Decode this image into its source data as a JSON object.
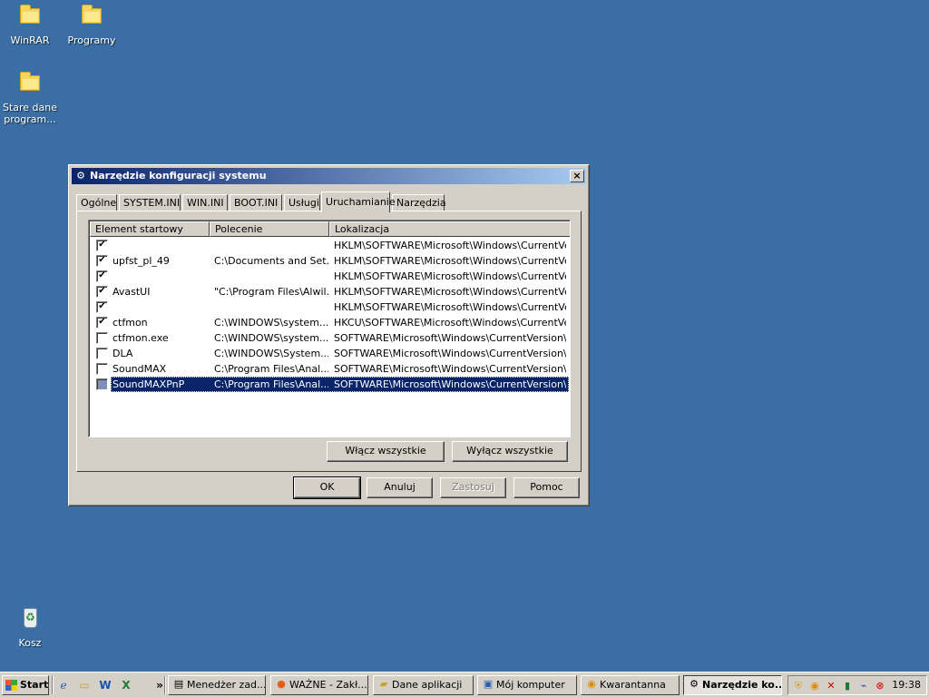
{
  "desktop": {
    "icons": [
      {
        "label": "WinRAR"
      },
      {
        "label": "Programy"
      },
      {
        "label": "Stare dane program..."
      },
      {
        "label": "Kosz"
      }
    ]
  },
  "dialog": {
    "title": "Narzędzie konfiguracji systemu",
    "close_glyph": "×",
    "tabs": [
      "Ogólne",
      "SYSTEM.INI",
      "WIN.INI",
      "BOOT.INI",
      "Usługi",
      "Uruchamianie",
      "Narzędzia"
    ],
    "active_tab": "Uruchamianie",
    "columns": [
      "Element startowy",
      "Polecenie",
      "Lokalizacja"
    ],
    "rows": [
      {
        "checked": "✔",
        "name": "",
        "command": "",
        "location": "HKLM\\SOFTWARE\\Microsoft\\Windows\\CurrentVer..."
      },
      {
        "checked": "✔",
        "name": "upfst_pl_49",
        "command": "C:\\Documents and Set...",
        "location": "HKLM\\SOFTWARE\\Microsoft\\Windows\\CurrentVer..."
      },
      {
        "checked": "✔",
        "name": "",
        "command": "",
        "location": "HKLM\\SOFTWARE\\Microsoft\\Windows\\CurrentVer..."
      },
      {
        "checked": "✔",
        "name": "AvastUI",
        "command": "\"C:\\Program Files\\Alwil...",
        "location": "HKLM\\SOFTWARE\\Microsoft\\Windows\\CurrentVer..."
      },
      {
        "checked": "✔",
        "name": "",
        "command": "",
        "location": "HKLM\\SOFTWARE\\Microsoft\\Windows\\CurrentVer..."
      },
      {
        "checked": "✔",
        "name": "ctfmon",
        "command": "C:\\WINDOWS\\system...",
        "location": "HKCU\\SOFTWARE\\Microsoft\\Windows\\CurrentVer..."
      },
      {
        "checked": "",
        "name": "ctfmon.exe",
        "command": "C:\\WINDOWS\\system...",
        "location": "SOFTWARE\\Microsoft\\Windows\\CurrentVersion\\Run"
      },
      {
        "checked": "",
        "name": "DLA",
        "command": "C:\\WINDOWS\\System...",
        "location": "SOFTWARE\\Microsoft\\Windows\\CurrentVersion\\Run"
      },
      {
        "checked": "",
        "name": "SoundMAX",
        "command": "C:\\Program Files\\Anal...",
        "location": "SOFTWARE\\Microsoft\\Windows\\CurrentVersion\\Run"
      },
      {
        "checked": "",
        "name": "SoundMAXPnP",
        "command": "C:\\Program Files\\Anal...",
        "location": "SOFTWARE\\Microsoft\\Windows\\CurrentVersion\\Run"
      }
    ],
    "enable_all": "Włącz wszystkie",
    "disable_all": "Wyłącz wszystkie",
    "ok": "OK",
    "cancel": "Anuluj",
    "apply": "Zastosuj",
    "help": "Pomoc"
  },
  "taskbar": {
    "start": "Start",
    "chevron": "»",
    "tasks": [
      {
        "label": "Menedżer zad..."
      },
      {
        "label": "WAŻNE - Zakł..."
      },
      {
        "label": "Dane aplikacji"
      },
      {
        "label": "Mój komputer"
      },
      {
        "label": "Kwarantanna"
      },
      {
        "label": "Narzędzie ko..."
      }
    ],
    "clock": "19:38"
  }
}
